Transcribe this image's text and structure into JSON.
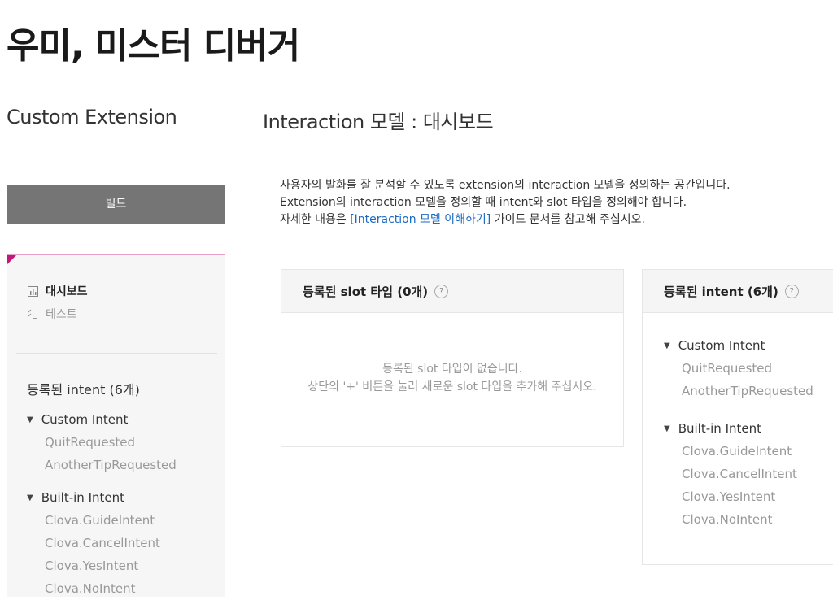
{
  "app_title": "우미, 미스터 디버거",
  "section_name": "Custom Extension",
  "page_title": "Interaction 모델 : 대시보드",
  "build_button": "빌드",
  "sidebar": {
    "nav": [
      {
        "label": "대시보드",
        "icon": "chart-icon"
      },
      {
        "label": "테스트",
        "icon": "checklist-icon"
      }
    ],
    "intents_title": "등록된 intent (6개)",
    "groups": [
      {
        "name": "Custom Intent",
        "items": [
          "QuitRequested",
          "AnotherTipRequested"
        ]
      },
      {
        "name": "Built-in Intent",
        "items": [
          "Clova.GuideIntent",
          "Clova.CancelIntent",
          "Clova.YesIntent",
          "Clova.NoIntent"
        ]
      }
    ]
  },
  "description": {
    "line1": "사용자의 발화를 잘 분석할 수 있도록 extension의 interaction 모델을 정의하는 공간입니다.",
    "line2": "Extension의 interaction 모델을 정의할 때 intent와 slot 타입을 정의해야 합니다.",
    "line3_prefix": "자세한 내용은 ",
    "line3_link": "[Interaction 모델 이해하기]",
    "line3_suffix": " 가이드 문서를 참고해 주십시오."
  },
  "slot_card": {
    "title": "등록된 slot 타입 (0개)",
    "empty_line1": "등록된 slot 타입이 없습니다.",
    "empty_line2": "상단의 '+' 버튼을 눌러 새로운 slot 타입을 추가해 주십시오."
  },
  "intent_card": {
    "title": "등록된 intent (6개)",
    "groups": [
      {
        "name": "Custom Intent",
        "items": [
          "QuitRequested",
          "AnotherTipRequested"
        ]
      },
      {
        "name": "Built-in Intent",
        "items": [
          "Clova.GuideIntent",
          "Clova.CancelIntent",
          "Clova.YesIntent",
          "Clova.NoIntent"
        ]
      }
    ]
  },
  "colors": {
    "accent": "#c2187a",
    "link": "#1a6ac4",
    "button": "#757575"
  }
}
